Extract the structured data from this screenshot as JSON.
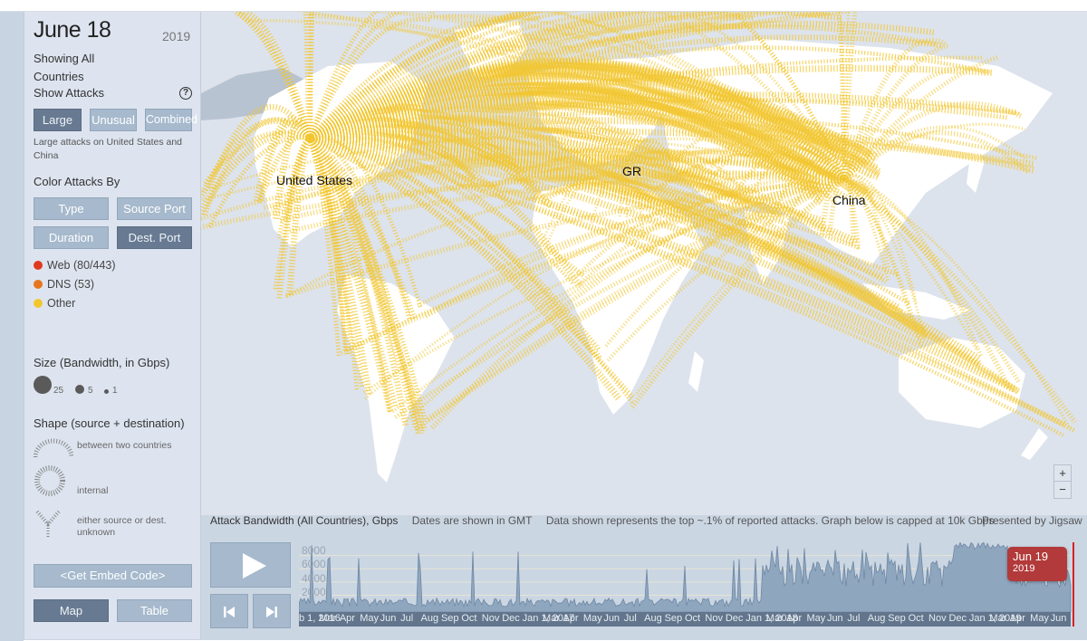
{
  "sidebar": {
    "date": "June 18",
    "year": "2019",
    "showing_line1": "Showing All",
    "showing_line2": "Countries",
    "show_attacks_label": "Show Attacks",
    "help_icon": "?",
    "attack_filters": [
      {
        "label": "Large",
        "active": true
      },
      {
        "label": "Unusual",
        "active": false
      },
      {
        "label": "Combined",
        "active": false
      }
    ],
    "attack_description": "Large attacks on United States and China",
    "color_by_label": "Color Attacks By",
    "color_by_options": [
      {
        "label": "Type",
        "active": false
      },
      {
        "label": "Source Port",
        "active": false
      },
      {
        "label": "Duration",
        "active": false
      },
      {
        "label": "Dest. Port",
        "active": true
      }
    ],
    "legend": [
      {
        "label": "Web (80/443)",
        "color": "#e03a1e"
      },
      {
        "label": "DNS (53)",
        "color": "#e8751e"
      },
      {
        "label": "Other",
        "color": "#f2c62f"
      }
    ],
    "size_title": "Size (Bandwidth, in Gbps)",
    "sizes": [
      "25",
      "5",
      "1"
    ],
    "shape_title": "Shape (source + destination)",
    "shapes": [
      {
        "label": "between two countries",
        "icon": "arc-icon"
      },
      {
        "label": "internal",
        "icon": "ring-icon"
      },
      {
        "label": "either source or dest. unknown",
        "icon": "funnel-icon"
      }
    ],
    "embed_label": "<Get Embed Code>",
    "view_tabs": [
      {
        "label": "Map",
        "active": true
      },
      {
        "label": "Table",
        "active": false
      }
    ]
  },
  "map": {
    "labels": [
      "United States",
      "GR",
      "China"
    ],
    "zoom_in": "+",
    "zoom_out": "−",
    "arc_color": "#f2c62f"
  },
  "info_bar": {
    "title": "Attack Bandwidth (All Countries), Gbps",
    "gmt_note": "Dates are shown in GMT",
    "data_note": "Data shown represents the top ~.1% of reported attacks. Graph below is capped at 10k Gbps",
    "credit": "Presented by Jigsaw"
  },
  "timeline": {
    "current_date": "Jun 19",
    "current_year": "2019",
    "accent": "#b23a3a",
    "y_ticks": [
      "8000",
      "6000",
      "4000",
      "2000"
    ],
    "axis_labels": [
      "b 1, 2016",
      "Mar",
      "Apr",
      "May",
      "Jun",
      "Jul",
      "Aug",
      "Sep",
      "Oct",
      "Nov",
      "Dec",
      "Jan 1, 2017",
      "Mar",
      "Apr",
      "May",
      "Jun",
      "Jul",
      "Aug",
      "Sep",
      "Oct",
      "Nov",
      "Dec",
      "Jan 1, 2018",
      "Mar",
      "Apr",
      "May",
      "Jun",
      "Jul",
      "Aug",
      "Sep",
      "Oct",
      "Nov",
      "Dec",
      "Jan 1, 2019",
      "Mar",
      "Apr",
      "May",
      "Jun"
    ]
  }
}
